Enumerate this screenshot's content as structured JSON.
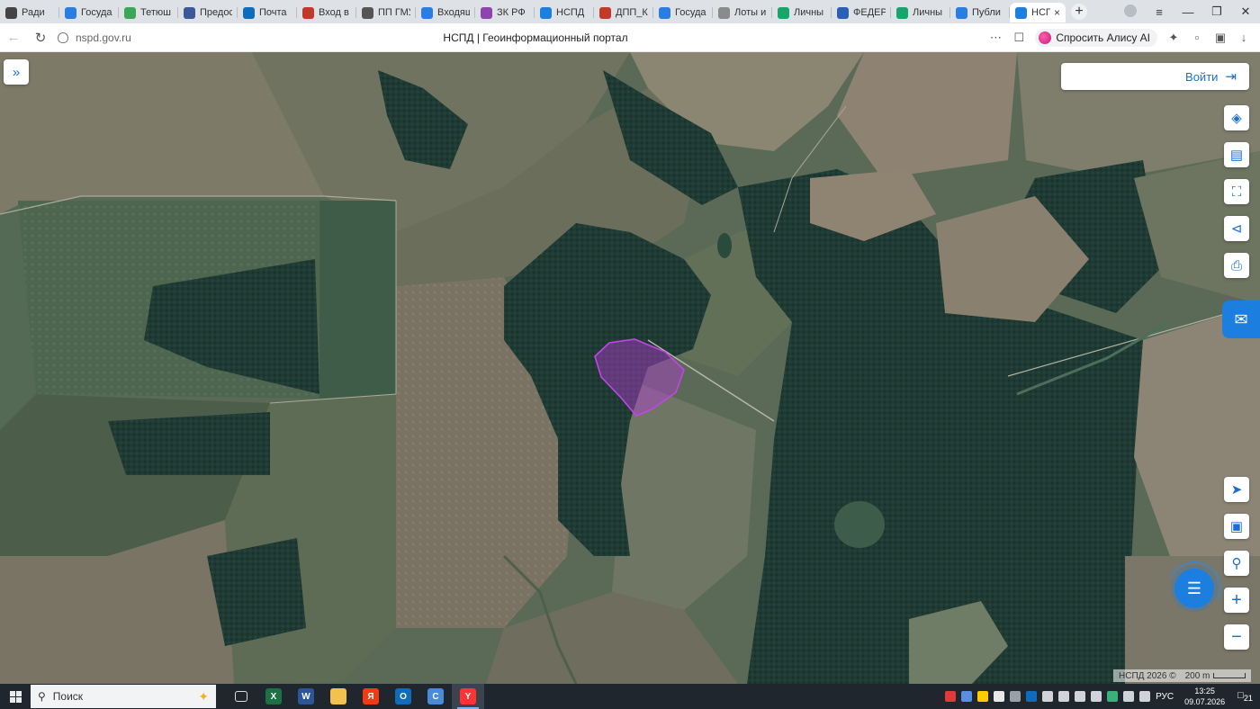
{
  "browser": {
    "tabs": [
      {
        "label": "Ради",
        "icon": "radio-icon",
        "color": "#444444"
      },
      {
        "label": "Госуда",
        "icon": "gov-icon",
        "color": "#2a7de1"
      },
      {
        "label": "Тетюш",
        "icon": "map-pin-icon",
        "color": "#3aa757"
      },
      {
        "label": "Предос",
        "icon": "gosuslugi-icon",
        "color": "#3b5998"
      },
      {
        "label": "Почта",
        "icon": "outlook-icon",
        "color": "#0f6cbd"
      },
      {
        "label": "Вход в",
        "icon": "shield-icon",
        "color": "#c0392b"
      },
      {
        "label": "ПП ГМУ",
        "icon": "emblem-icon",
        "color": "#555555"
      },
      {
        "label": "Входящ",
        "icon": "mail-icon",
        "color": "#2a7de1"
      },
      {
        "label": "ЗК РФ",
        "icon": "law-icon",
        "color": "#8e44ad"
      },
      {
        "label": "НСПД",
        "icon": "nspd-icon",
        "color": "#1c7fe0"
      },
      {
        "label": "ДПП_К",
        "icon": "doc-icon",
        "color": "#c0392b"
      },
      {
        "label": "Госуда",
        "icon": "gov-icon",
        "color": "#2a7de1"
      },
      {
        "label": "Лоты и",
        "icon": "page-icon",
        "color": "#8a8a8a"
      },
      {
        "label": "Личны",
        "icon": "tax-icon",
        "color": "#1aa36b"
      },
      {
        "label": "ФЕДЕР",
        "icon": "globe-icon",
        "color": "#2b5fb3"
      },
      {
        "label": "Личны",
        "icon": "tax-icon",
        "color": "#1aa36b"
      },
      {
        "label": "Публи",
        "icon": "public-map-icon",
        "color": "#2a7de1"
      },
      {
        "label": "НСП",
        "icon": "nspd-icon",
        "color": "#1c7fe0",
        "active": true
      }
    ],
    "url": "nspd.gov.ru",
    "page_title": "НСПД | Геоинформационный портал",
    "alice_label": "Спросить Алису AI"
  },
  "map": {
    "login_label": "Войти",
    "tools": [
      "layers-icon",
      "ruler-icon",
      "select-area-icon",
      "share-icon",
      "print-icon"
    ],
    "nav_tools": [
      "locate-icon",
      "basemap-icon",
      "search-location-icon"
    ],
    "zoom_in": "+",
    "zoom_out": "−",
    "attribution": "НСПД 2026 ©",
    "scale_label": "200 m",
    "highlight_color": "#b43cd2"
  },
  "taskbar": {
    "search_placeholder": "Поиск",
    "apps": [
      {
        "name": "task-view",
        "label": "",
        "color": "#ffffff"
      },
      {
        "name": "excel",
        "label": "X",
        "color": "#1d7145"
      },
      {
        "name": "word",
        "label": "W",
        "color": "#2b579a"
      },
      {
        "name": "explorer",
        "label": "",
        "color": "#f2c14e"
      },
      {
        "name": "yandex",
        "label": "Я",
        "color": "#f33a12"
      },
      {
        "name": "outlook",
        "label": "O",
        "color": "#0f6cbd"
      },
      {
        "name": "cortex",
        "label": "C",
        "color": "#4a8ad8"
      },
      {
        "name": "yandex-browser",
        "label": "Y",
        "color": "#ff3333",
        "active": true
      }
    ],
    "lang": "РУС",
    "time": "13:25",
    "date": "09.07.2026",
    "notifications": "21"
  }
}
